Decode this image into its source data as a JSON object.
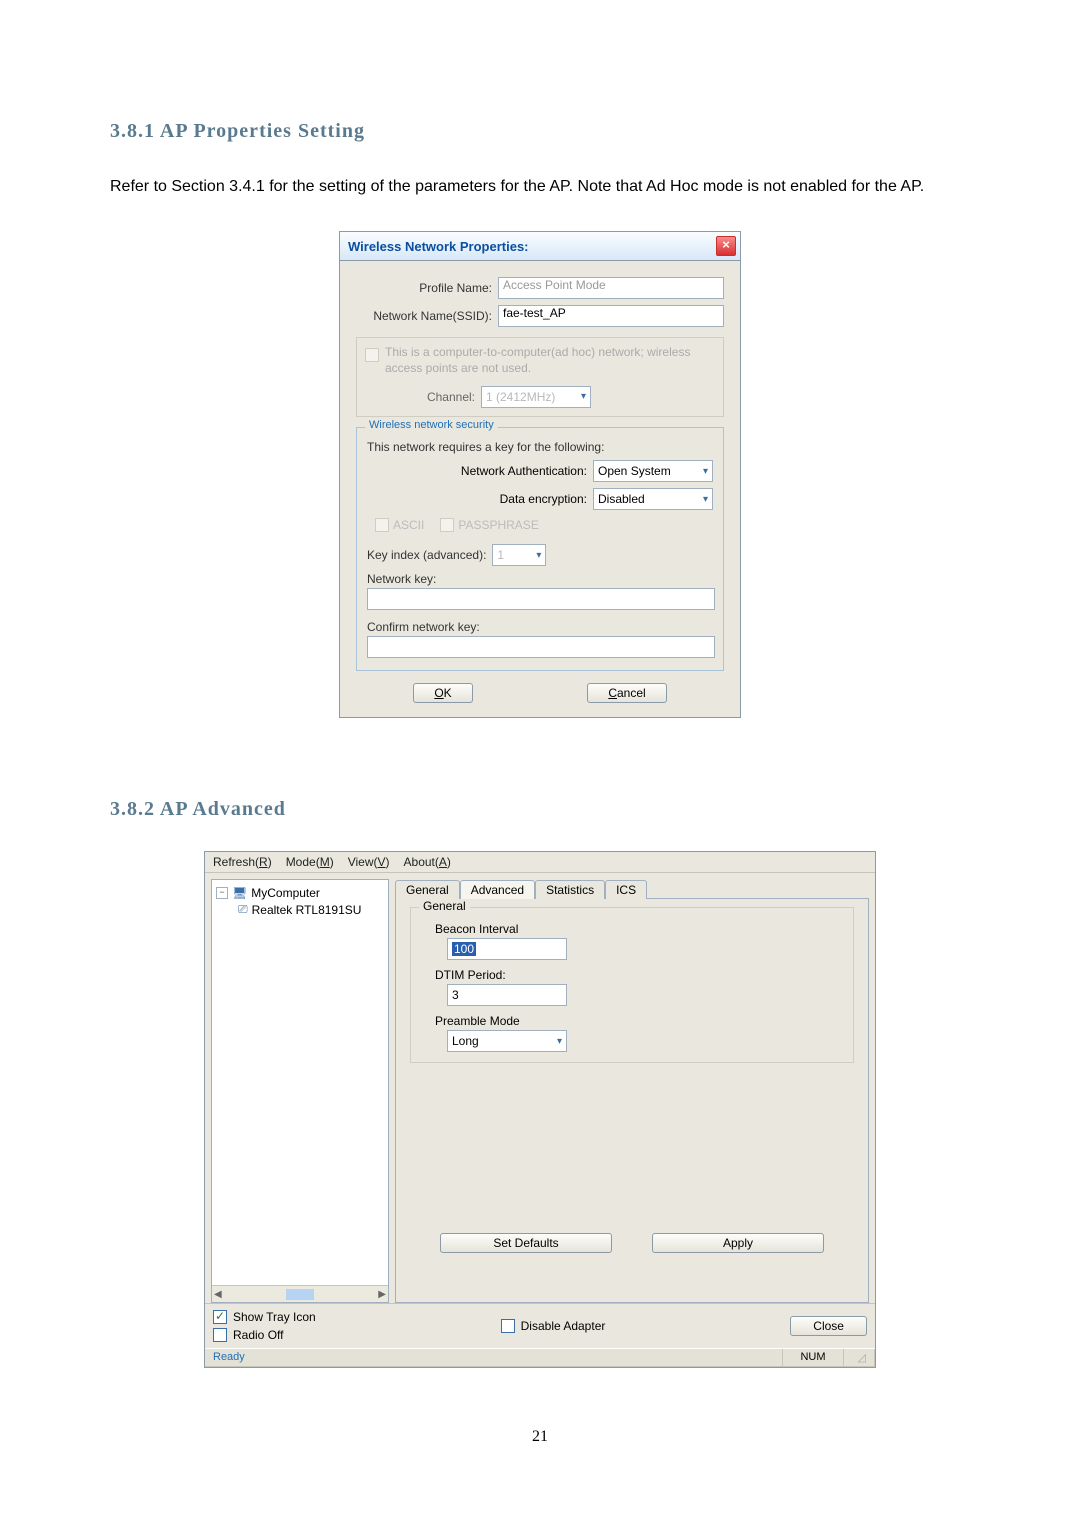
{
  "section1": {
    "heading": "3.8.1   AP Properties Setting",
    "paragraph": "Refer to Section 3.4.1 for the setting of the parameters for the AP. Note that Ad Hoc mode is not enabled for the AP."
  },
  "dialog1": {
    "title": "Wireless Network Properties:",
    "close_glyph": "×",
    "profile_name_label": "Profile Name:",
    "profile_name_value": "Access Point Mode",
    "ssid_label": "Network Name(SSID):",
    "ssid_value": "fae-test_AP",
    "adhoc_text": "This is a computer-to-computer(ad hoc) network; wireless access points are not used.",
    "channel_label": "Channel:",
    "channel_value": "1 (2412MHz)",
    "security_legend": "Wireless network security",
    "security_hint": "This network requires a key for the following:",
    "auth_label": "Network Authentication:",
    "auth_value": "Open System",
    "enc_label": "Data encryption:",
    "enc_value": "Disabled",
    "ascii_label": "ASCII",
    "pass_label": "PASSPHRASE",
    "keyidx_label": "Key index (advanced):",
    "keyidx_value": "1",
    "netkey_label": "Network key:",
    "confkey_label": "Confirm network key:",
    "ok_label": "OK",
    "cancel_label": "Cancel"
  },
  "section2": {
    "heading": "3.8.2   AP Advanced"
  },
  "window2": {
    "menu": {
      "refresh": "Refresh(R)",
      "mode": "Mode(M)",
      "view": "View(V)",
      "about": "About(A)"
    },
    "tree": {
      "root": "MyComputer",
      "child": "Realtek RTL8191SU "
    },
    "tabs": {
      "general": "General",
      "advanced": "Advanced",
      "statistics": "Statistics",
      "ics": "ICS"
    },
    "group_label": "General",
    "beacon_label": "Beacon Interval",
    "beacon_value": "100",
    "dtim_label": "DTIM Period:",
    "dtim_value": "3",
    "preamble_label": "Preamble Mode",
    "preamble_value": "Long",
    "set_defaults": "Set Defaults",
    "apply": "Apply",
    "show_tray": "Show Tray Icon",
    "radio_off": "Radio Off",
    "disable_adapter": "Disable Adapter",
    "close": "Close",
    "status_ready": "Ready",
    "status_num": "NUM"
  },
  "page_number": "21"
}
